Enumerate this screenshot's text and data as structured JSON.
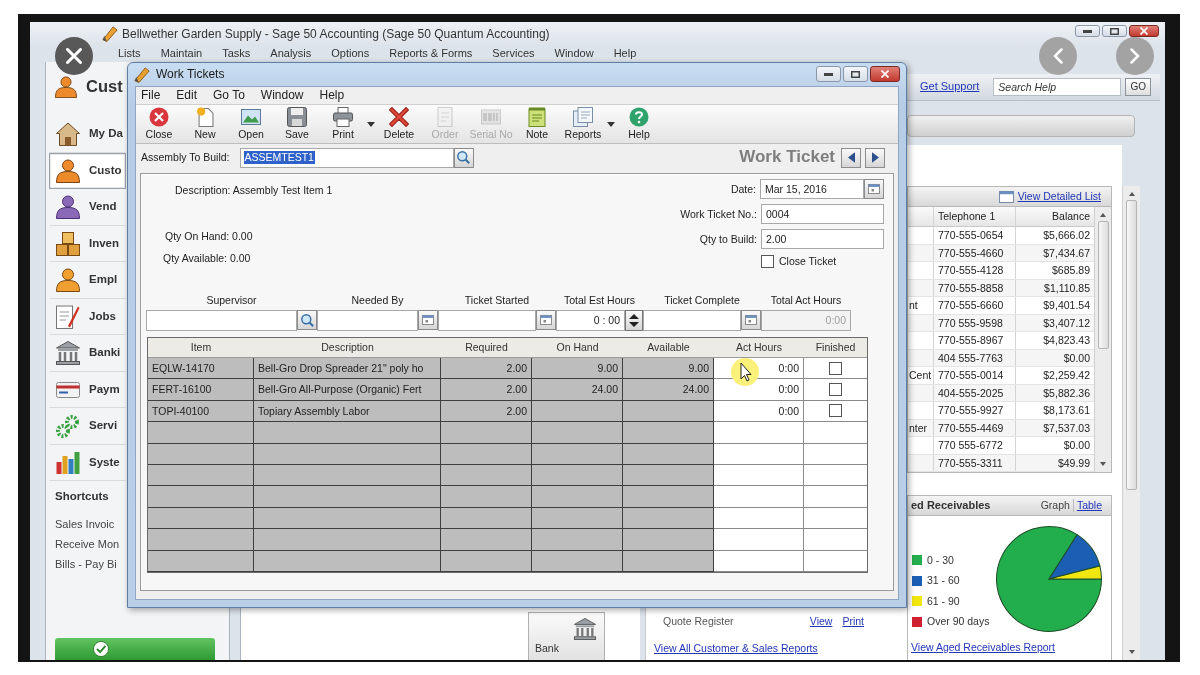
{
  "app": {
    "title": "Bellwether Garden Supply - Sage 50 Accounting (Sage 50 Quantum Accounting)",
    "menu": [
      "Lists",
      "Maintain",
      "Tasks",
      "Analysis",
      "Options",
      "Reports & Forms",
      "Services",
      "Window",
      "Help"
    ]
  },
  "sidebar": {
    "header": "Cust",
    "items": [
      {
        "kind": "dashboard",
        "label": "My Da",
        "selected": false
      },
      {
        "kind": "customers",
        "label": "Custo",
        "selected": true
      },
      {
        "kind": "vendors",
        "label": "Vend",
        "selected": false
      },
      {
        "kind": "inventory",
        "label": "Inven",
        "selected": false
      },
      {
        "kind": "employees",
        "label": "Empl",
        "selected": false
      },
      {
        "kind": "jobs",
        "label": "Jobs",
        "selected": false
      },
      {
        "kind": "banking",
        "label": "Banki",
        "selected": false
      },
      {
        "kind": "payments",
        "label": "Paym",
        "selected": false
      },
      {
        "kind": "services",
        "label": "Servi",
        "selected": false
      },
      {
        "kind": "system",
        "label": "Syste",
        "selected": false
      }
    ],
    "shortcuts": {
      "title": "Shortcuts",
      "items": [
        "Sales Invoic",
        "Receive Mon",
        "Bills - Pay Bi"
      ]
    }
  },
  "center": {
    "tile": "Bank",
    "quote_register": {
      "label": "Quote Register",
      "links": [
        "View",
        "Print"
      ]
    },
    "reports_link": "View All Customer & Sales Reports"
  },
  "help_bar": {
    "link": "Get Support",
    "search": {
      "placeholder": "Search Help"
    },
    "button": "GO"
  },
  "customers": {
    "link": "View Detailed List",
    "columns": [
      "Telephone 1",
      "Balance"
    ],
    "rows": [
      {
        "telephone_1": "770-555-0654",
        "balance": "$5,666.02"
      },
      {
        "telephone_1": "770-555-4660",
        "balance": "$7,434.67"
      },
      {
        "telephone_1": "770-555-4128",
        "balance": "$685.89"
      },
      {
        "telephone_1": "770-555-8858",
        "balance": "$1,110.85"
      },
      {
        "column_1": "nt",
        "telephone_1": "770-555-6660",
        "balance": "$9,401.54"
      },
      {
        "telephone_1": "770 555-9598",
        "balance": "$3,407.12"
      },
      {
        "telephone_1": "770-555-8967",
        "balance": "$4,823.43"
      },
      {
        "telephone_1": "404 555-7763",
        "balance": "$0.00"
      },
      {
        "column_1": "Cent",
        "telephone_1": "770-555-0014",
        "balance": "$2,259.42"
      },
      {
        "telephone_1": "404-555-2025",
        "balance": "$5,882.36"
      },
      {
        "telephone_1": "770-555-9927",
        "balance": "$8,173.61"
      },
      {
        "column_1": "nter",
        "telephone_1": "770-555-4469",
        "balance": "$7,537.03"
      },
      {
        "telephone_1": "770 555-6772",
        "balance": "$0.00"
      },
      {
        "telephone_1": "770-555-3311",
        "balance": "$49.99"
      }
    ]
  },
  "aged_receivables": {
    "title": "ed Receivables",
    "views": [
      {
        "label": "Graph",
        "selected": true
      },
      {
        "label": "Table",
        "selected": false
      }
    ],
    "chart_data": {
      "type": "pie",
      "categories": [
        "0 - 30",
        "31 - 60",
        "61 - 90",
        "Over 90 days"
      ],
      "values": [
        84,
        12,
        4,
        0
      ],
      "colors": [
        "#22ae4c",
        "#1b5fb5",
        "#f2e611",
        "#cf2030"
      ]
    },
    "link": "View Aged Receivables Report"
  },
  "work_tickets": {
    "title": "Work Tickets",
    "menu": [
      "File",
      "Edit",
      "Go To",
      "Window",
      "Help"
    ],
    "toolbar": [
      {
        "kind": "close",
        "label": "Close",
        "disabled": false,
        "dropdown": false
      },
      {
        "kind": "new",
        "label": "New",
        "disabled": false,
        "dropdown": false
      },
      {
        "kind": "open",
        "label": "Open",
        "disabled": false,
        "dropdown": false
      },
      {
        "kind": "save",
        "label": "Save",
        "disabled": false,
        "dropdown": false
      },
      {
        "kind": "print",
        "label": "Print",
        "disabled": false,
        "dropdown": true
      },
      {
        "kind": "delete",
        "label": "Delete",
        "disabled": false,
        "dropdown": false
      },
      {
        "kind": "order",
        "label": "Order",
        "disabled": true,
        "dropdown": false
      },
      {
        "kind": "serial",
        "label": "Serial No",
        "disabled": true,
        "dropdown": false
      },
      {
        "kind": "note",
        "label": "Note",
        "disabled": false,
        "dropdown": false
      },
      {
        "kind": "reports",
        "label": "Reports",
        "disabled": false,
        "dropdown": true
      },
      {
        "kind": "help",
        "label": "Help",
        "disabled": false,
        "dropdown": false
      }
    ],
    "assembly": {
      "label": "Assembly To Build:",
      "value": "ASSEMTEST1",
      "highlighted": true
    },
    "heading": "Work Ticket",
    "info": [
      "Description: Assembly Test Item 1",
      "Qty On Hand: 0.00",
      "Qty Available: 0.00"
    ],
    "fields": [
      {
        "kind": "date",
        "label": "Date:",
        "value": "Mar 15, 2016"
      },
      {
        "kind": "text",
        "label": "Work Ticket No.:",
        "value": "0004"
      },
      {
        "kind": "text",
        "label": "Qty to Build:",
        "value": "2.00"
      }
    ],
    "close_ticket": {
      "label": "Close Ticket",
      "checked": false
    },
    "schedule": [
      {
        "kind": "lookup",
        "label": "Supervisor"
      },
      {
        "kind": "date",
        "label": "Needed By"
      },
      {
        "kind": "date",
        "label": "Ticket Started"
      },
      {
        "kind": "spinner",
        "label": "Total Est Hours",
        "value": "0 : 00"
      },
      {
        "kind": "date",
        "label": "Ticket Complete"
      },
      {
        "kind": "readonly",
        "label": "Total Act Hours",
        "value": "0:00"
      }
    ],
    "grid": {
      "columns": [
        "Item",
        "Description",
        "Required",
        "On Hand",
        "Available",
        "Act Hours",
        "Finished"
      ],
      "rows": [
        {
          "item": "EQLW-14170",
          "description": "Bell-Gro Drop Spreader 21\" poly ho",
          "required": "2.00",
          "on_hand": "9.00",
          "available": "9.00",
          "act_hours": "0:00",
          "finished": false
        },
        {
          "item": "FERT-16100",
          "description": "Bell-Gro All-Purpose (Organic) Fert",
          "required": "2.00",
          "on_hand": "24.00",
          "available": "24.00",
          "act_hours": "0:00",
          "finished": false
        },
        {
          "item": "TOPI-40100",
          "description": "Topiary Assembly Labor",
          "required": "2.00",
          "act_hours": "0:00",
          "finished": false
        }
      ]
    }
  }
}
